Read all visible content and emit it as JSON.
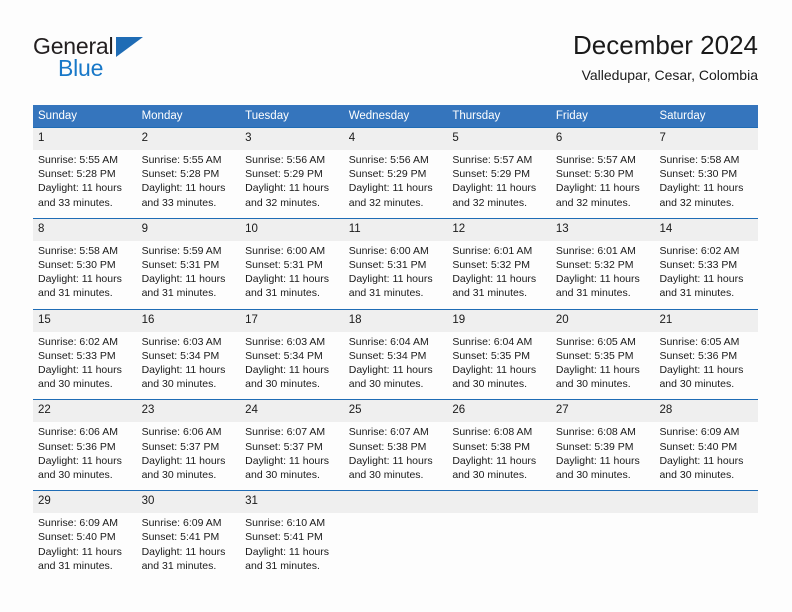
{
  "logo": {
    "word_one": "General",
    "word_two": "Blue",
    "triangle_icon": "triangle-icon",
    "accent_color": "#1878c8"
  },
  "header": {
    "title": "December 2024",
    "subtitle": "Valledupar, Cesar, Colombia"
  },
  "theme": {
    "header_bg": "#3575bd",
    "header_text": "#ffffff",
    "daynum_bg": "#efefef",
    "week_rule": "#1f6cb5",
    "page_bg": "#fdfdfd"
  },
  "weekdays": [
    "Sunday",
    "Monday",
    "Tuesday",
    "Wednesday",
    "Thursday",
    "Friday",
    "Saturday"
  ],
  "weeks": [
    {
      "daynums": [
        "1",
        "2",
        "3",
        "4",
        "5",
        "6",
        "7"
      ],
      "cells": [
        {
          "sunrise": "Sunrise: 5:55 AM",
          "sunset": "Sunset: 5:28 PM",
          "daylight_1": "Daylight: 11 hours",
          "daylight_2": "and 33 minutes."
        },
        {
          "sunrise": "Sunrise: 5:55 AM",
          "sunset": "Sunset: 5:28 PM",
          "daylight_1": "Daylight: 11 hours",
          "daylight_2": "and 33 minutes."
        },
        {
          "sunrise": "Sunrise: 5:56 AM",
          "sunset": "Sunset: 5:29 PM",
          "daylight_1": "Daylight: 11 hours",
          "daylight_2": "and 32 minutes."
        },
        {
          "sunrise": "Sunrise: 5:56 AM",
          "sunset": "Sunset: 5:29 PM",
          "daylight_1": "Daylight: 11 hours",
          "daylight_2": "and 32 minutes."
        },
        {
          "sunrise": "Sunrise: 5:57 AM",
          "sunset": "Sunset: 5:29 PM",
          "daylight_1": "Daylight: 11 hours",
          "daylight_2": "and 32 minutes."
        },
        {
          "sunrise": "Sunrise: 5:57 AM",
          "sunset": "Sunset: 5:30 PM",
          "daylight_1": "Daylight: 11 hours",
          "daylight_2": "and 32 minutes."
        },
        {
          "sunrise": "Sunrise: 5:58 AM",
          "sunset": "Sunset: 5:30 PM",
          "daylight_1": "Daylight: 11 hours",
          "daylight_2": "and 32 minutes."
        }
      ]
    },
    {
      "daynums": [
        "8",
        "9",
        "10",
        "11",
        "12",
        "13",
        "14"
      ],
      "cells": [
        {
          "sunrise": "Sunrise: 5:58 AM",
          "sunset": "Sunset: 5:30 PM",
          "daylight_1": "Daylight: 11 hours",
          "daylight_2": "and 31 minutes."
        },
        {
          "sunrise": "Sunrise: 5:59 AM",
          "sunset": "Sunset: 5:31 PM",
          "daylight_1": "Daylight: 11 hours",
          "daylight_2": "and 31 minutes."
        },
        {
          "sunrise": "Sunrise: 6:00 AM",
          "sunset": "Sunset: 5:31 PM",
          "daylight_1": "Daylight: 11 hours",
          "daylight_2": "and 31 minutes."
        },
        {
          "sunrise": "Sunrise: 6:00 AM",
          "sunset": "Sunset: 5:31 PM",
          "daylight_1": "Daylight: 11 hours",
          "daylight_2": "and 31 minutes."
        },
        {
          "sunrise": "Sunrise: 6:01 AM",
          "sunset": "Sunset: 5:32 PM",
          "daylight_1": "Daylight: 11 hours",
          "daylight_2": "and 31 minutes."
        },
        {
          "sunrise": "Sunrise: 6:01 AM",
          "sunset": "Sunset: 5:32 PM",
          "daylight_1": "Daylight: 11 hours",
          "daylight_2": "and 31 minutes."
        },
        {
          "sunrise": "Sunrise: 6:02 AM",
          "sunset": "Sunset: 5:33 PM",
          "daylight_1": "Daylight: 11 hours",
          "daylight_2": "and 31 minutes."
        }
      ]
    },
    {
      "daynums": [
        "15",
        "16",
        "17",
        "18",
        "19",
        "20",
        "21"
      ],
      "cells": [
        {
          "sunrise": "Sunrise: 6:02 AM",
          "sunset": "Sunset: 5:33 PM",
          "daylight_1": "Daylight: 11 hours",
          "daylight_2": "and 30 minutes."
        },
        {
          "sunrise": "Sunrise: 6:03 AM",
          "sunset": "Sunset: 5:34 PM",
          "daylight_1": "Daylight: 11 hours",
          "daylight_2": "and 30 minutes."
        },
        {
          "sunrise": "Sunrise: 6:03 AM",
          "sunset": "Sunset: 5:34 PM",
          "daylight_1": "Daylight: 11 hours",
          "daylight_2": "and 30 minutes."
        },
        {
          "sunrise": "Sunrise: 6:04 AM",
          "sunset": "Sunset: 5:34 PM",
          "daylight_1": "Daylight: 11 hours",
          "daylight_2": "and 30 minutes."
        },
        {
          "sunrise": "Sunrise: 6:04 AM",
          "sunset": "Sunset: 5:35 PM",
          "daylight_1": "Daylight: 11 hours",
          "daylight_2": "and 30 minutes."
        },
        {
          "sunrise": "Sunrise: 6:05 AM",
          "sunset": "Sunset: 5:35 PM",
          "daylight_1": "Daylight: 11 hours",
          "daylight_2": "and 30 minutes."
        },
        {
          "sunrise": "Sunrise: 6:05 AM",
          "sunset": "Sunset: 5:36 PM",
          "daylight_1": "Daylight: 11 hours",
          "daylight_2": "and 30 minutes."
        }
      ]
    },
    {
      "daynums": [
        "22",
        "23",
        "24",
        "25",
        "26",
        "27",
        "28"
      ],
      "cells": [
        {
          "sunrise": "Sunrise: 6:06 AM",
          "sunset": "Sunset: 5:36 PM",
          "daylight_1": "Daylight: 11 hours",
          "daylight_2": "and 30 minutes."
        },
        {
          "sunrise": "Sunrise: 6:06 AM",
          "sunset": "Sunset: 5:37 PM",
          "daylight_1": "Daylight: 11 hours",
          "daylight_2": "and 30 minutes."
        },
        {
          "sunrise": "Sunrise: 6:07 AM",
          "sunset": "Sunset: 5:37 PM",
          "daylight_1": "Daylight: 11 hours",
          "daylight_2": "and 30 minutes."
        },
        {
          "sunrise": "Sunrise: 6:07 AM",
          "sunset": "Sunset: 5:38 PM",
          "daylight_1": "Daylight: 11 hours",
          "daylight_2": "and 30 minutes."
        },
        {
          "sunrise": "Sunrise: 6:08 AM",
          "sunset": "Sunset: 5:38 PM",
          "daylight_1": "Daylight: 11 hours",
          "daylight_2": "and 30 minutes."
        },
        {
          "sunrise": "Sunrise: 6:08 AM",
          "sunset": "Sunset: 5:39 PM",
          "daylight_1": "Daylight: 11 hours",
          "daylight_2": "and 30 minutes."
        },
        {
          "sunrise": "Sunrise: 6:09 AM",
          "sunset": "Sunset: 5:40 PM",
          "daylight_1": "Daylight: 11 hours",
          "daylight_2": "and 30 minutes."
        }
      ]
    },
    {
      "daynums": [
        "29",
        "30",
        "31",
        "",
        "",
        "",
        ""
      ],
      "cells": [
        {
          "sunrise": "Sunrise: 6:09 AM",
          "sunset": "Sunset: 5:40 PM",
          "daylight_1": "Daylight: 11 hours",
          "daylight_2": "and 31 minutes."
        },
        {
          "sunrise": "Sunrise: 6:09 AM",
          "sunset": "Sunset: 5:41 PM",
          "daylight_1": "Daylight: 11 hours",
          "daylight_2": "and 31 minutes."
        },
        {
          "sunrise": "Sunrise: 6:10 AM",
          "sunset": "Sunset: 5:41 PM",
          "daylight_1": "Daylight: 11 hours",
          "daylight_2": "and 31 minutes."
        },
        {
          "sunrise": "",
          "sunset": "",
          "daylight_1": "",
          "daylight_2": ""
        },
        {
          "sunrise": "",
          "sunset": "",
          "daylight_1": "",
          "daylight_2": ""
        },
        {
          "sunrise": "",
          "sunset": "",
          "daylight_1": "",
          "daylight_2": ""
        },
        {
          "sunrise": "",
          "sunset": "",
          "daylight_1": "",
          "daylight_2": ""
        }
      ]
    }
  ]
}
